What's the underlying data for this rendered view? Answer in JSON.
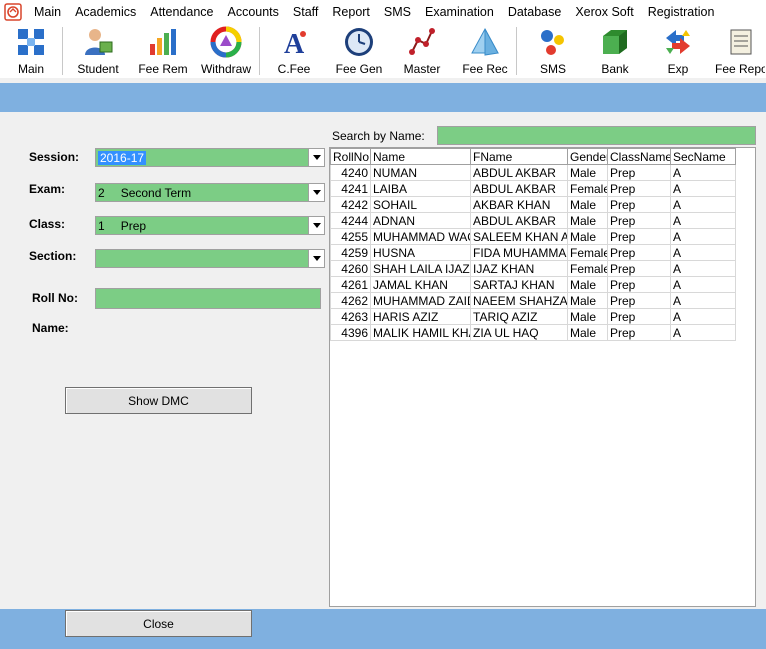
{
  "menu": {
    "items": [
      "Main",
      "Academics",
      "Attendance",
      "Accounts",
      "Staff",
      "Report",
      "SMS",
      "Examination",
      "Database",
      "Xerox Soft",
      "Registration"
    ]
  },
  "toolbar": {
    "buttons": [
      {
        "label": "Main",
        "icon": "grid-blocks-icon"
      },
      {
        "label": "Student",
        "icon": "student-user-icon"
      },
      {
        "label": "Fee Rem",
        "icon": "bar-chart-icon"
      },
      {
        "label": "Withdraw",
        "icon": "color-wheel-icon"
      },
      {
        "label": "C.Fee",
        "icon": "font-a-icon"
      },
      {
        "label": "Fee Gen",
        "icon": "clock-icon"
      },
      {
        "label": "Master",
        "icon": "line-nodes-icon"
      },
      {
        "label": "Fee Rec",
        "icon": "pyramid-icon"
      },
      {
        "label": "SMS",
        "icon": "molecule-icon"
      },
      {
        "label": "Bank",
        "icon": "bank-box-icon"
      },
      {
        "label": "Exp",
        "icon": "arrows-exchange-icon"
      },
      {
        "label": "Fee Repo",
        "icon": "scroll-icon"
      }
    ]
  },
  "form": {
    "session_label": "Session:",
    "session_value": "2016-17",
    "exam_label": "Exam:",
    "exam_code": "2",
    "exam_value": "Second Term",
    "class_label": "Class:",
    "class_code": "1",
    "class_value": "Prep",
    "section_label": "Section:",
    "section_value": "",
    "rollno_label": "Roll No:",
    "rollno_value": "",
    "name_label": "Name:",
    "show_dmc_label": "Show DMC",
    "close_label": "Close"
  },
  "search": {
    "label": "Search by Name:",
    "value": ""
  },
  "grid": {
    "columns": [
      "RollNo",
      "Name",
      "FName",
      "Gender",
      "ClassName",
      "SecName"
    ],
    "rows": [
      [
        "4240",
        "NUMAN",
        "ABDUL AKBAR",
        "Male",
        "Prep",
        "A"
      ],
      [
        "4241",
        "LAIBA",
        "ABDUL AKBAR",
        "Female",
        "Prep",
        "A"
      ],
      [
        "4242",
        "SOHAIL",
        "AKBAR KHAN",
        "Male",
        "Prep",
        "A"
      ],
      [
        "4244",
        "ADNAN",
        "ABDUL AKBAR",
        "Male",
        "Prep",
        "A"
      ],
      [
        "4255",
        "MUHAMMAD WAQ",
        "SALEEM KHAN AF",
        "Male",
        "Prep",
        "A"
      ],
      [
        "4259",
        "HUSNA",
        "FIDA MUHAMMAD",
        "Female",
        "Prep",
        "A"
      ],
      [
        "4260",
        "SHAH LAILA IJAZ",
        "IJAZ KHAN",
        "Female",
        "Prep",
        "A"
      ],
      [
        "4261",
        "JAMAL KHAN",
        "SARTAJ KHAN",
        "Male",
        "Prep",
        "A"
      ],
      [
        "4262",
        "MUHAMMAD ZAID",
        "NAEEM SHAHZAC",
        "Male",
        "Prep",
        "A"
      ],
      [
        "4263",
        "HARIS AZIZ",
        "TARIQ AZIZ",
        "Male",
        "Prep",
        "A"
      ],
      [
        "4396",
        "MALIK HAMIL KHA",
        "ZIA UL HAQ",
        "Male",
        "Prep",
        "A"
      ]
    ]
  },
  "colors": {
    "field_green": "#7ccd85",
    "band_blue": "#7fb0e0",
    "selection_blue": "#3390ff"
  }
}
